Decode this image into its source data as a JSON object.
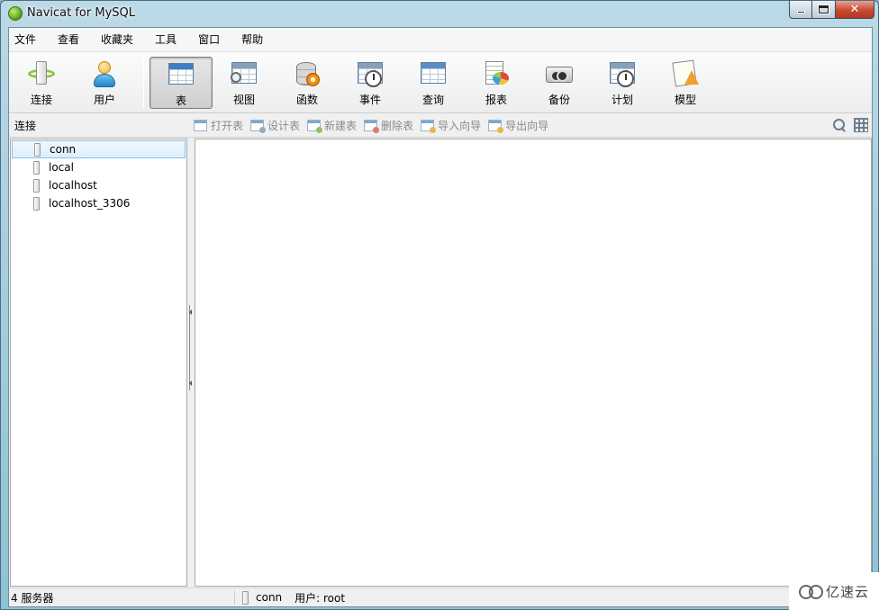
{
  "window": {
    "title": "Navicat for MySQL"
  },
  "menu": [
    "文件",
    "查看",
    "收藏夹",
    "工具",
    "窗口",
    "帮助"
  ],
  "toolbar": {
    "connection_buttons": [
      {
        "label": "连接",
        "icon": "connect-plug-icon"
      },
      {
        "label": "用户",
        "icon": "user-icon"
      }
    ],
    "object_buttons": [
      {
        "label": "表",
        "icon": "table-icon",
        "active": true
      },
      {
        "label": "视图",
        "icon": "view-icon"
      },
      {
        "label": "函数",
        "icon": "function-icon"
      },
      {
        "label": "事件",
        "icon": "event-icon"
      },
      {
        "label": "查询",
        "icon": "query-icon"
      },
      {
        "label": "报表",
        "icon": "report-icon"
      },
      {
        "label": "备份",
        "icon": "backup-icon"
      },
      {
        "label": "计划",
        "icon": "schedule-icon"
      },
      {
        "label": "模型",
        "icon": "model-icon"
      }
    ]
  },
  "object_bar": {
    "left_label": "连接",
    "actions": [
      {
        "label": "打开表",
        "icon": "open-table-icon"
      },
      {
        "label": "设计表",
        "icon": "design-table-icon"
      },
      {
        "label": "新建表",
        "icon": "new-table-icon"
      },
      {
        "label": "删除表",
        "icon": "delete-table-icon"
      },
      {
        "label": "导入向导",
        "icon": "import-wizard-icon"
      },
      {
        "label": "导出向导",
        "icon": "export-wizard-icon"
      }
    ]
  },
  "connections": [
    {
      "name": "conn",
      "selected": true
    },
    {
      "name": "local",
      "selected": false
    },
    {
      "name": "localhost",
      "selected": false
    },
    {
      "name": "localhost_3306",
      "selected": false
    }
  ],
  "status": {
    "server_count": "4 服务器",
    "connection": "conn",
    "user": "用户: root"
  },
  "watermark": {
    "text": "亿速云"
  },
  "colors": {
    "accent": "#3d7fc4",
    "selection_border": "#8fbfe6",
    "close_button": "#c64a32"
  }
}
